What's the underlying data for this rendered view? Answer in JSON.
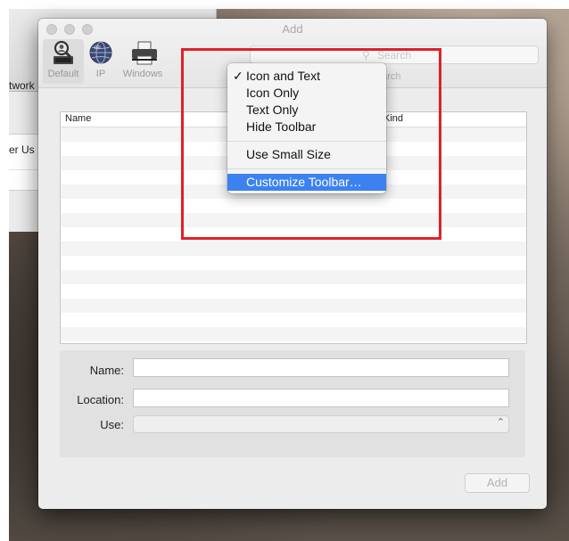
{
  "background_window": {
    "network_label": "twork",
    "user_label": "er Us"
  },
  "window": {
    "title": "Add",
    "toolbar": [
      {
        "label": "Default",
        "icon": "magnifier-person-icon"
      },
      {
        "label": "IP",
        "icon": "globe-icon"
      },
      {
        "label": "Windows",
        "icon": "printer-icon"
      }
    ],
    "search": {
      "placeholder": "Search",
      "label": "earch"
    },
    "table": {
      "columns": [
        "Name",
        "Kind"
      ],
      "rows": []
    },
    "form": {
      "name_label": "Name:",
      "location_label": "Location:",
      "use_label": "Use:",
      "name_value": "",
      "location_value": "",
      "use_value": ""
    },
    "add_button": "Add"
  },
  "context_menu": {
    "items": [
      {
        "label": "Icon and Text",
        "checked": true
      },
      {
        "label": "Icon Only"
      },
      {
        "label": "Text Only"
      },
      {
        "label": "Hide Toolbar"
      },
      {
        "label": "Use Small Size"
      },
      {
        "label": "Customize Toolbar…",
        "highlighted": true
      }
    ],
    "checkmark": "✓"
  },
  "colors": {
    "highlight": "#3b82f0",
    "annotation": "#e0202a"
  }
}
